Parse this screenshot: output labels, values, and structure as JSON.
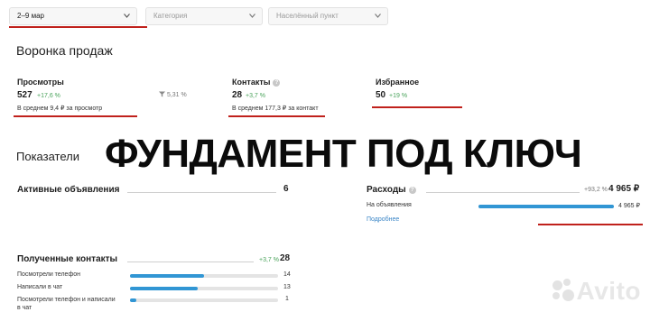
{
  "filters": {
    "date": "2–9 мар",
    "category_placeholder": "Категория",
    "location_placeholder": "Населённый пункт"
  },
  "funnel": {
    "title": "Воронка продаж",
    "views": {
      "label": "Просмотры",
      "value": "527",
      "delta": "+17,6 %",
      "sub": "В среднем 9,4 ₽ за просмотр"
    },
    "conversion": "5,31 %",
    "contacts": {
      "label": "Контакты",
      "value": "28",
      "delta": "+3,7 %",
      "sub": "В среднем 177,3 ₽ за контакт"
    },
    "favorites": {
      "label": "Избранное",
      "value": "50",
      "delta": "+19 %"
    }
  },
  "banner_text": "ФУНДАМЕНТ ПОД КЛЮЧ",
  "indicators": {
    "title": "Показатели",
    "active_ads": {
      "label": "Активные объявления",
      "value": "6"
    },
    "expenses": {
      "label": "Расходы",
      "delta": "+93,2 %",
      "value": "4 965 ₽",
      "row_label": "На объявления",
      "row_value": "4 965 ₽",
      "row_fraction": 1.0,
      "more_link": "Подробнее"
    },
    "contacts_received": {
      "label": "Полученные контакты",
      "delta": "+3,7 %",
      "value": "28",
      "rows": [
        {
          "label": "Посмотрели телефон",
          "value": "14",
          "fraction": 0.5
        },
        {
          "label": "Написали в чат",
          "value": "13",
          "fraction": 0.46
        },
        {
          "label": "Посмотрели телефон и написали в чат",
          "value": "1",
          "fraction": 0.04
        }
      ]
    }
  },
  "watermark": "Avito",
  "colors": {
    "accent_red": "#c0211c",
    "bar_blue": "#3196d4",
    "positive_green": "#4aa35b",
    "link_blue": "#3b86c7"
  },
  "icons": {
    "dropdown": "chevron-down-icon",
    "help": "help-icon",
    "funnel": "funnel-icon",
    "logo": "avito-logo-icon"
  }
}
